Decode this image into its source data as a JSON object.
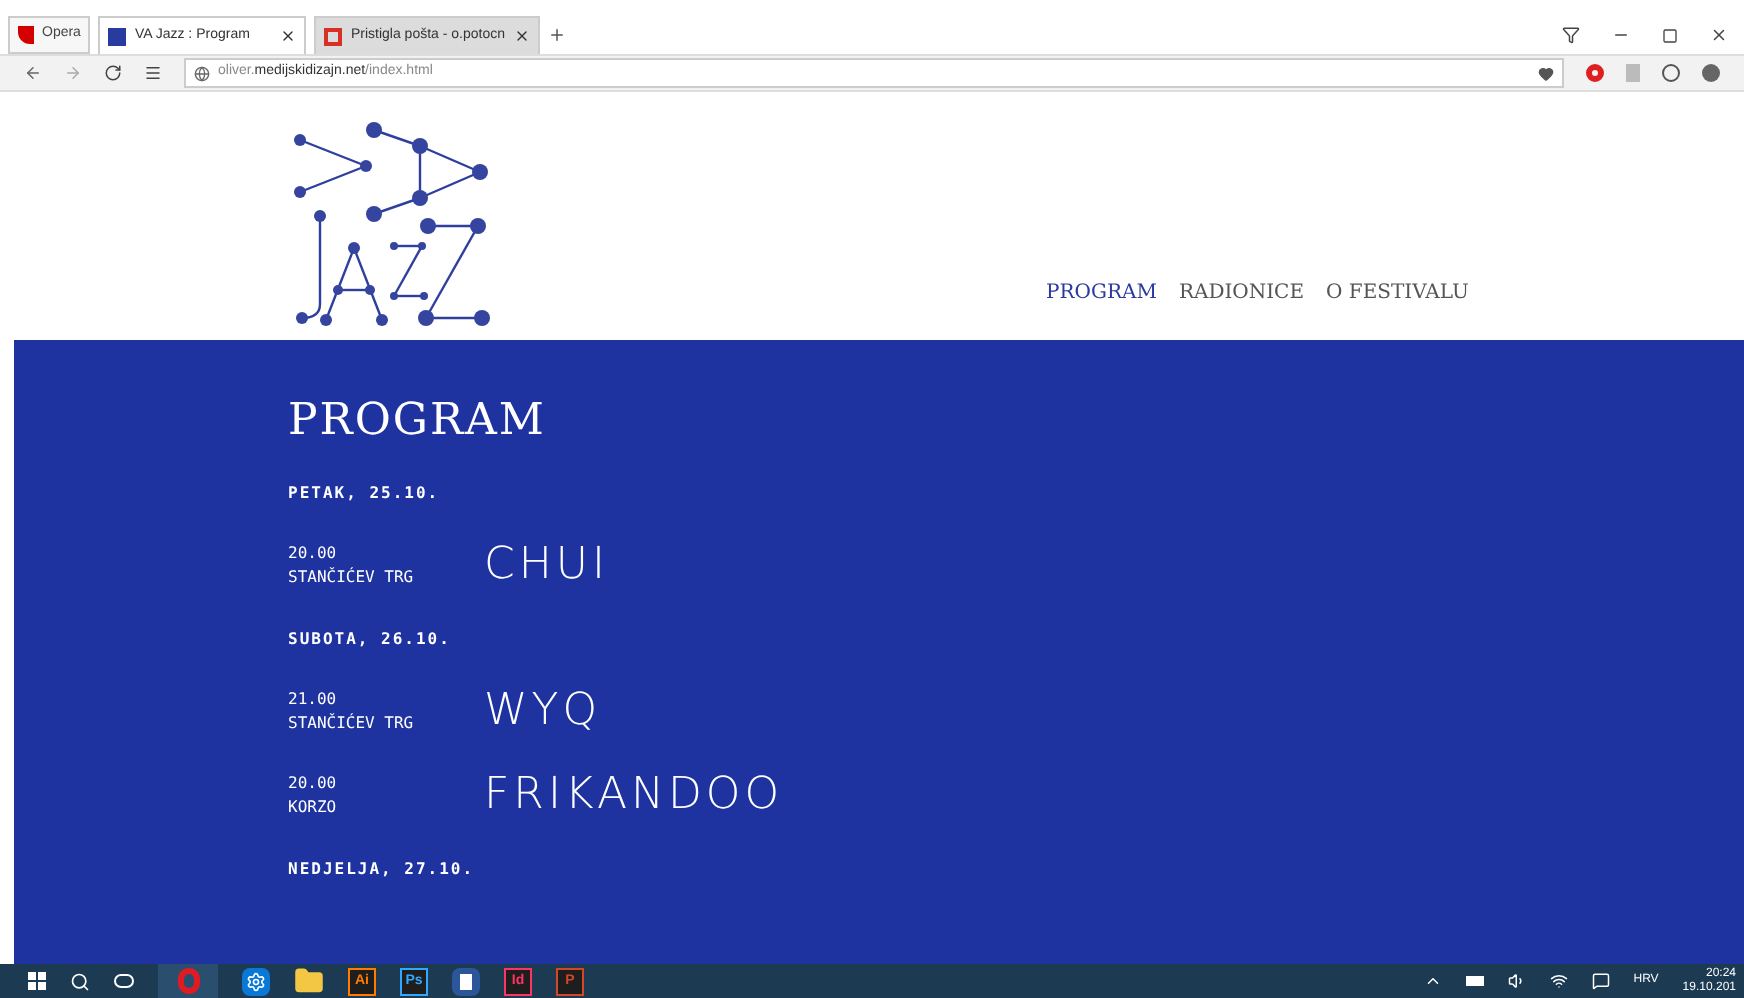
{
  "browser": {
    "menu_label": "Opera",
    "tabs": [
      {
        "title": "VA Jazz : Program",
        "selected": true
      },
      {
        "title": "Pristigla pošta - o.potocn",
        "selected": false
      }
    ],
    "url": {
      "prefix": "oliver.",
      "domain": "medijskidizajn.net",
      "path": "/index.html"
    }
  },
  "nav": [
    {
      "label": "PROGRAM",
      "selected": true
    },
    {
      "label": "RADIONICE",
      "selected": false
    },
    {
      "label": "O FESTIVALU",
      "selected": false
    }
  ],
  "program": {
    "title": "PROGRAM",
    "days": [
      {
        "date": "PETAK, 25.10.",
        "events": [
          {
            "time": "20.00",
            "venue": "STANČIĆEV TRG",
            "name": "CHUI"
          }
        ]
      },
      {
        "date": "SUBOTA, 26.10.",
        "events": [
          {
            "time": "21.00",
            "venue": "STANČIĆEV TRG",
            "name": "WYQ"
          },
          {
            "time": "20.00",
            "venue": "KORZO",
            "name": "FRIKANDOO"
          }
        ]
      },
      {
        "date": "NEDJELJA, 27.10."
      }
    ]
  },
  "taskbar": {
    "apps": [
      {
        "kind": "opera"
      },
      {
        "kind": "settings"
      },
      {
        "kind": "folder"
      },
      {
        "kind": "letter",
        "label": "Ai",
        "color": "#ff7c00"
      },
      {
        "kind": "letter",
        "label": "Ps",
        "color": "#31a8ff"
      },
      {
        "kind": "word"
      },
      {
        "kind": "letter",
        "label": "Id",
        "color": "#ff3366"
      },
      {
        "kind": "letter",
        "label": "P",
        "color": "#d24726"
      }
    ],
    "language": "HRV",
    "time": "20:24",
    "date": "19.10.201"
  }
}
